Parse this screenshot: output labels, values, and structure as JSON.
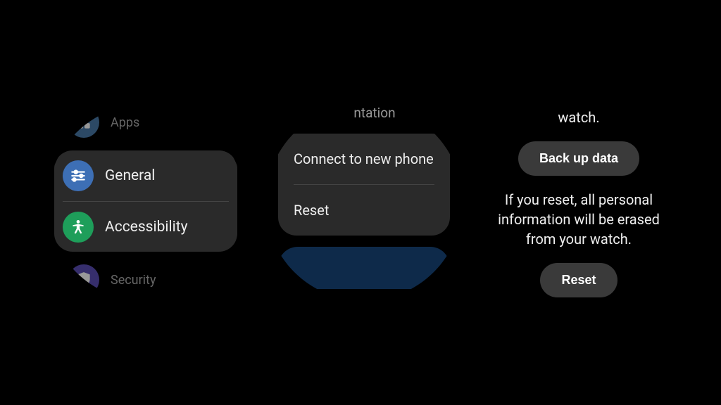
{
  "colors": {
    "apps_icon_bg": "#4a7aa8",
    "general_icon_bg": "#3d6fb5",
    "accessibility_icon_bg": "#1e9e5a",
    "security_icon_bg": "#5a4db5"
  },
  "screen1": {
    "items": {
      "apps": {
        "label": "Apps"
      },
      "general": {
        "label": "General"
      },
      "accessibility": {
        "label": "Accessibility"
      },
      "security": {
        "label": "Security"
      }
    }
  },
  "screen2": {
    "top_item": "Orientation",
    "menu": {
      "connect": "Connect to new phone",
      "reset": "Reset"
    }
  },
  "screen3": {
    "top_fragment": "watch.",
    "backup_btn": "Back up data",
    "warning": "If you reset, all personal information will be erased from your watch.",
    "reset_btn": "Reset"
  }
}
